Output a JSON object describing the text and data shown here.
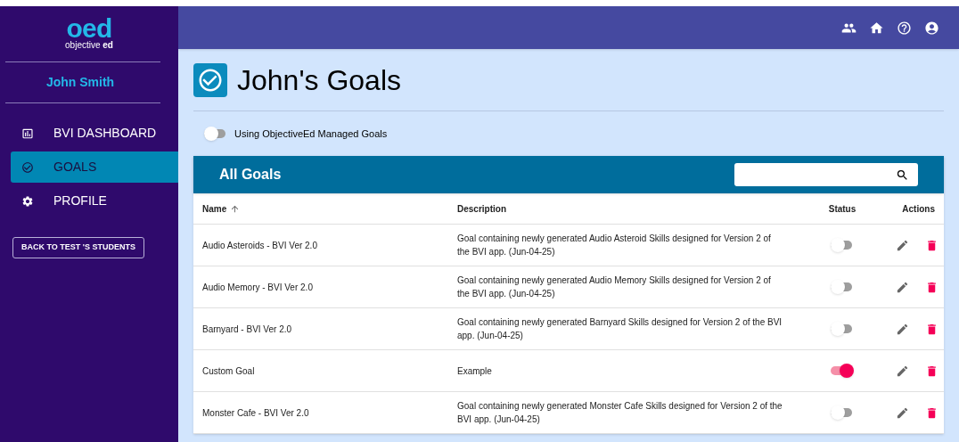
{
  "logo": {
    "mark": "oed",
    "tagline": "objective **ed**"
  },
  "user": {
    "name": "John Smith"
  },
  "nav": [
    {
      "kind": "dashboard",
      "label": "BVI DASHBOARD",
      "selected": false
    },
    {
      "kind": "goals",
      "label": "GOALS",
      "selected": true
    },
    {
      "kind": "profile",
      "label": "PROFILE",
      "selected": false
    }
  ],
  "back_button": "BACK TO TEST 'S STUDENTS",
  "header_icons": [
    {
      "kind": "people"
    },
    {
      "kind": "home"
    },
    {
      "kind": "help"
    },
    {
      "kind": "account"
    }
  ],
  "page_title": "John's Goals",
  "managed_toggle": {
    "label": "Using ObjectiveEd Managed Goals",
    "on": false
  },
  "table": {
    "title": "All Goals",
    "columns": [
      {
        "label": "Name",
        "sorted": true
      },
      {
        "label": "Description",
        "sorted": false
      },
      {
        "label": "Status",
        "sorted": false
      },
      {
        "label": "Actions",
        "sorted": false
      }
    ],
    "rows": [
      {
        "name": "Audio Asteroids - BVI Ver 2.0",
        "description": "Goal containing newly generated Audio Asteroid Skills designed for Version 2 of the BVI app. (Jun-04-25)",
        "on": false
      },
      {
        "name": "Audio Memory - BVI Ver 2.0",
        "description": "Goal containing newly generated Audio Memory Skills designed for Version 2 of the BVI app. (Jun-04-25)",
        "on": false
      },
      {
        "name": "Barnyard - BVI Ver 2.0",
        "description": "Goal containing newly generated Barnyard Skills designed for Version 2 of the BVI app. (Jun-04-25)",
        "on": false
      },
      {
        "name": "Custom Goal",
        "description": "Example",
        "on": true
      },
      {
        "name": "Monster Cafe - BVI Ver 2.0",
        "description": "Goal containing newly generated Monster Cafe Skills designed for Version 2 of the BVI app. (Jun-04-25)",
        "on": false
      }
    ]
  }
}
